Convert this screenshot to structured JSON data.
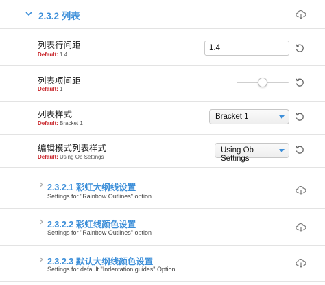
{
  "section": {
    "title": "2.3.2 列表",
    "expand_icon": "chevron-down-icon",
    "download_icon": "cloud-download-icon"
  },
  "settings": [
    {
      "name": "列表行间距",
      "default_label": "Default:",
      "default_value": "1.4",
      "control": "text",
      "value": "1.4"
    },
    {
      "name": "列表项间距",
      "default_label": "Default:",
      "default_value": "1",
      "control": "slider",
      "value_fraction": 0.5
    },
    {
      "name": "列表样式",
      "default_label": "Default:",
      "default_value": "Bracket 1",
      "control": "select",
      "value": "Bracket 1"
    },
    {
      "name": "编辑模式列表样式",
      "default_label": "Default:",
      "default_value": "Using Ob Settings",
      "control": "select",
      "value": "Using Ob Settings"
    }
  ],
  "subsections": [
    {
      "title": "2.3.2.1 彩虹大纲线设置",
      "desc": "Settings for \"Rainbow Outlines\" option"
    },
    {
      "title": "2.3.2.2 彩虹线颜色设置",
      "desc": "Settings for \"Rainbow Outlines\" option"
    },
    {
      "title": "2.3.2.3 默认大纲线颜色设置",
      "desc": "Settings for default \"Indentation guides\" Option"
    }
  ],
  "colors": {
    "accent": "#3d8fd9",
    "default_label": "#c9282d",
    "divider": "#e3e3e3"
  }
}
